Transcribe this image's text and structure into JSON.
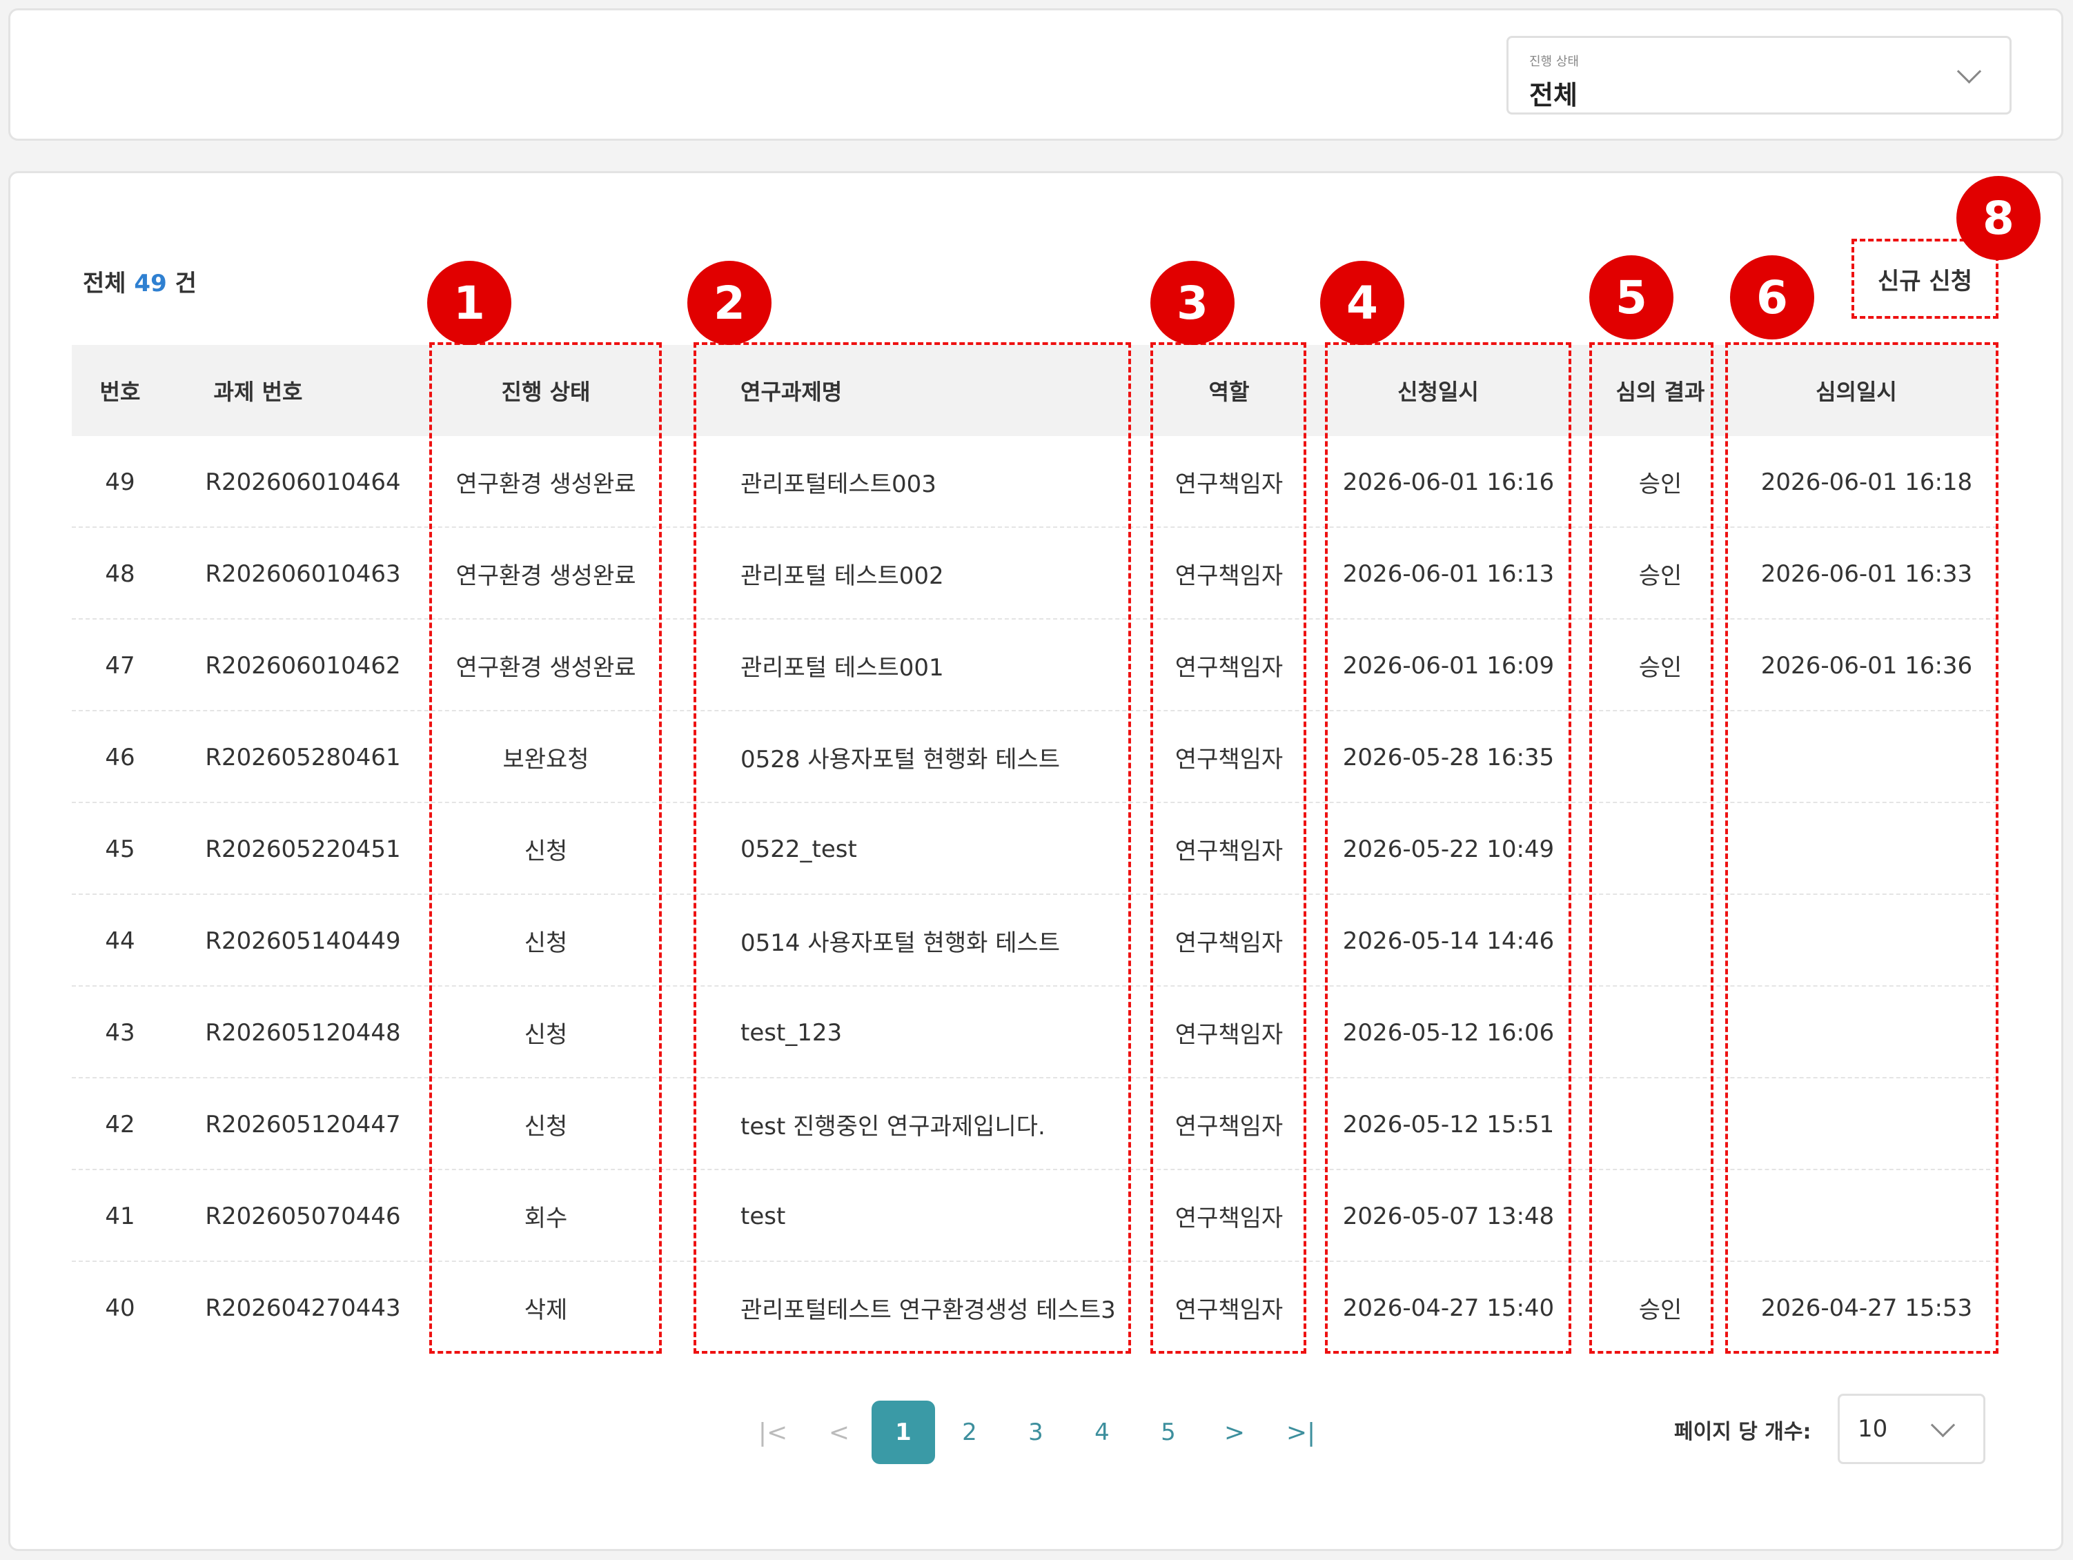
{
  "filter": {
    "status_label": "진행 상태",
    "status_value": "전체"
  },
  "list": {
    "total_prefix": "전체",
    "total_count": "49",
    "total_suffix": "건",
    "new_button": "신규 신청",
    "columns": {
      "no": "번호",
      "project_no": "과제 번호",
      "status": "진행 상태",
      "title": "연구과제명",
      "role": "역할",
      "applied_at": "신청일시",
      "review_result": "심의 결과",
      "reviewed_at": "심의일시"
    },
    "rows": [
      {
        "no": "49",
        "project_no": "R202606010464",
        "status": "연구환경 생성완료",
        "title": "관리포털테스트003",
        "role": "연구책임자",
        "applied_at": "2026-06-01 16:16",
        "review_result": "승인",
        "reviewed_at": "2026-06-01 16:18"
      },
      {
        "no": "48",
        "project_no": "R202606010463",
        "status": "연구환경 생성완료",
        "title": "관리포털 테스트002",
        "role": "연구책임자",
        "applied_at": "2026-06-01 16:13",
        "review_result": "승인",
        "reviewed_at": "2026-06-01 16:33"
      },
      {
        "no": "47",
        "project_no": "R202606010462",
        "status": "연구환경 생성완료",
        "title": "관리포털 테스트001",
        "role": "연구책임자",
        "applied_at": "2026-06-01 16:09",
        "review_result": "승인",
        "reviewed_at": "2026-06-01 16:36"
      },
      {
        "no": "46",
        "project_no": "R202605280461",
        "status": "보완요청",
        "title": "0528 사용자포털 현행화 테스트",
        "role": "연구책임자",
        "applied_at": "2026-05-28 16:35",
        "review_result": "",
        "reviewed_at": ""
      },
      {
        "no": "45",
        "project_no": "R202605220451",
        "status": "신청",
        "title": "0522_test",
        "role": "연구책임자",
        "applied_at": "2026-05-22 10:49",
        "review_result": "",
        "reviewed_at": ""
      },
      {
        "no": "44",
        "project_no": "R202605140449",
        "status": "신청",
        "title": "0514 사용자포털 현행화 테스트",
        "role": "연구책임자",
        "applied_at": "2026-05-14 14:46",
        "review_result": "",
        "reviewed_at": ""
      },
      {
        "no": "43",
        "project_no": "R202605120448",
        "status": "신청",
        "title": "test_123",
        "role": "연구책임자",
        "applied_at": "2026-05-12 16:06",
        "review_result": "",
        "reviewed_at": ""
      },
      {
        "no": "42",
        "project_no": "R202605120447",
        "status": "신청",
        "title": "test 진행중인 연구과제입니다.",
        "role": "연구책임자",
        "applied_at": "2026-05-12 15:51",
        "review_result": "",
        "reviewed_at": ""
      },
      {
        "no": "41",
        "project_no": "R202605070446",
        "status": "회수",
        "title": "test",
        "role": "연구책임자",
        "applied_at": "2026-05-07 13:48",
        "review_result": "",
        "reviewed_at": ""
      },
      {
        "no": "40",
        "project_no": "R202604270443",
        "status": "삭제",
        "title": "관리포털테스트 연구환경생성 테스트3",
        "role": "연구책임자",
        "applied_at": "2026-04-27 15:40",
        "review_result": "승인",
        "reviewed_at": "2026-04-27 15:53"
      }
    ]
  },
  "annotations": {
    "status_col": "1",
    "title_col": "2",
    "role_col": "3",
    "applied_col": "4",
    "result_col": "5",
    "reviewed_col": "6",
    "new_button": "8"
  },
  "pagination": {
    "first": "|<",
    "prev": "<",
    "pages": [
      "1",
      "2",
      "3",
      "4",
      "5"
    ],
    "active_page": "1",
    "next": ">",
    "last": ">|",
    "per_page_label": "페이지 당 개수:",
    "per_page_value": "10"
  }
}
